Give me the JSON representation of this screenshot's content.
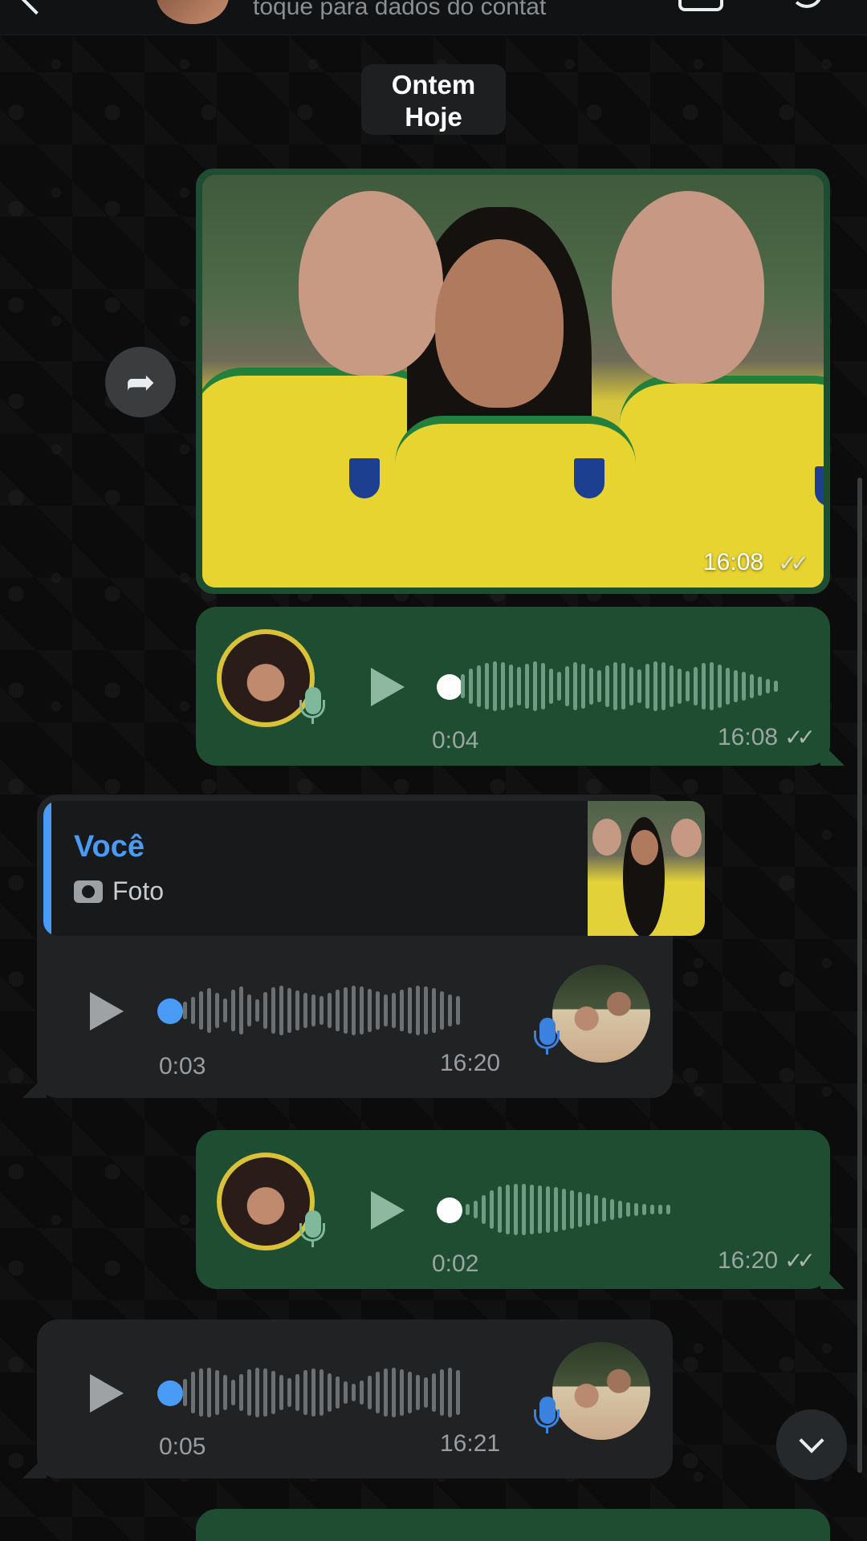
{
  "header": {
    "subtitle": "toque para dados do contat"
  },
  "date_chip": {
    "line1": "Ontem",
    "line2": "Hoje"
  },
  "image_message": {
    "time": "16:08",
    "status": "read"
  },
  "messages": [
    {
      "direction": "outgoing",
      "duration": "0:04",
      "time": "16:08"
    },
    {
      "direction": "incoming",
      "quote": {
        "author": "Você",
        "type": "Foto"
      },
      "duration": "0:03",
      "time": "16:20"
    },
    {
      "direction": "outgoing",
      "duration": "0:02",
      "time": "16:20"
    },
    {
      "direction": "incoming",
      "duration": "0:05",
      "time": "16:21"
    }
  ],
  "icons": {
    "forward": "forward-icon",
    "scroll_down": "chevron-down-icon",
    "mic": "microphone-icon",
    "camera": "camera-icon",
    "play": "play-icon"
  },
  "colors": {
    "outgoing_bubble": "#1e4d32",
    "incoming_bubble": "#202224",
    "accent_blue": "#4a9bf5",
    "background": "#0b0b0b"
  }
}
